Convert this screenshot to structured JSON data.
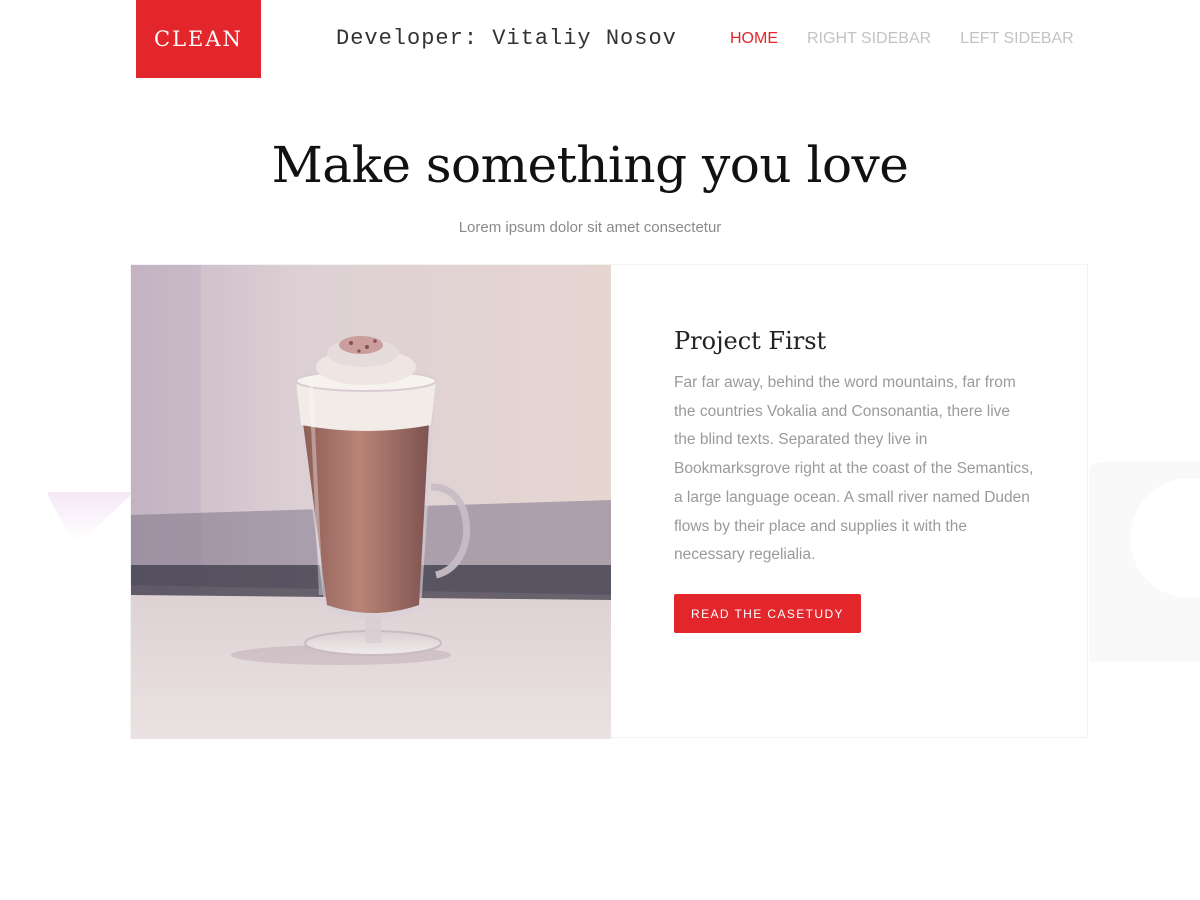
{
  "header": {
    "logo": "CLEAN",
    "developer": "Developer: Vitaliy Nosov",
    "nav": [
      {
        "label": "HOME",
        "active": true
      },
      {
        "label": "RIGHT SIDEBAR",
        "active": false
      },
      {
        "label": "LEFT SIDEBAR",
        "active": false
      }
    ]
  },
  "hero": {
    "title": "Make something you love",
    "subtitle": "Lorem ipsum dolor sit amet consectetur"
  },
  "project": {
    "title": "Project First",
    "text": "Far far away, behind the word mountains, far from the countries Vokalia and Consonantia, there live the blind texts. Separated they live in Bookmarksgrove right at the coast of the Semantics, a large language ocean. A small river named Duden flows by their place and supplies it with the necessary regelialia.",
    "button": "READ THE CASETUDY",
    "image": "hot-chocolate-glass-photo"
  },
  "colors": {
    "accent": "#e3262b",
    "nav_inactive": "#c3c3c3",
    "body_text": "#9a9a9a"
  }
}
